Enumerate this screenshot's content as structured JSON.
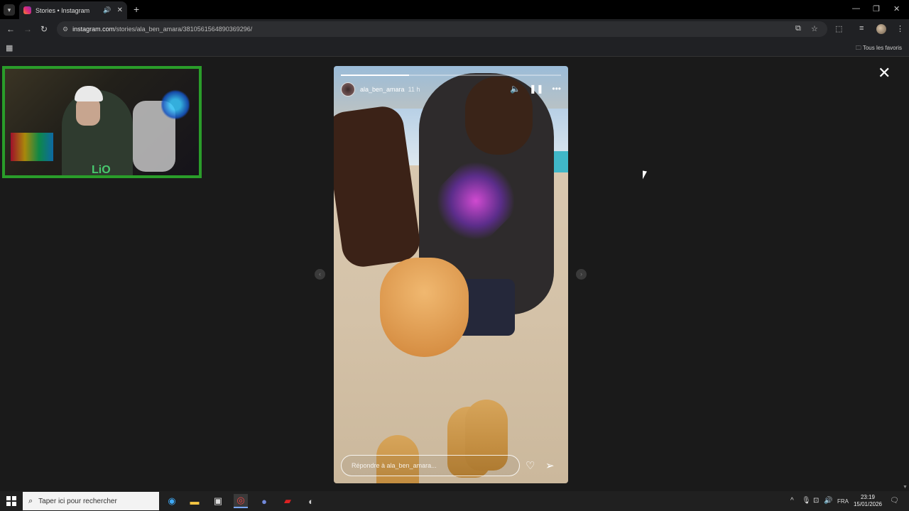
{
  "browser": {
    "tab_title": "Stories • Instagram",
    "url_host": "instagram.com",
    "url_path": "/stories/ala_ben_amara/3810561564890369296/",
    "bookmarks_label": "Tous les favoris"
  },
  "story": {
    "username": "ala_ben_amara",
    "time_ago": "11 h",
    "progress": 0.31,
    "reply_placeholder": "Répondre à ala_ben_amara..."
  },
  "webcam": {
    "overlay_text": "LiO"
  },
  "taskbar": {
    "search_placeholder": "Taper ici pour rechercher",
    "language": "FRA",
    "time": "23:19",
    "date": "15/01/2026"
  },
  "colors": {
    "webcam_border": "#2a9d2a",
    "instagram_gradient": [
      "#f58529",
      "#dd2a7b",
      "#8134af"
    ]
  }
}
